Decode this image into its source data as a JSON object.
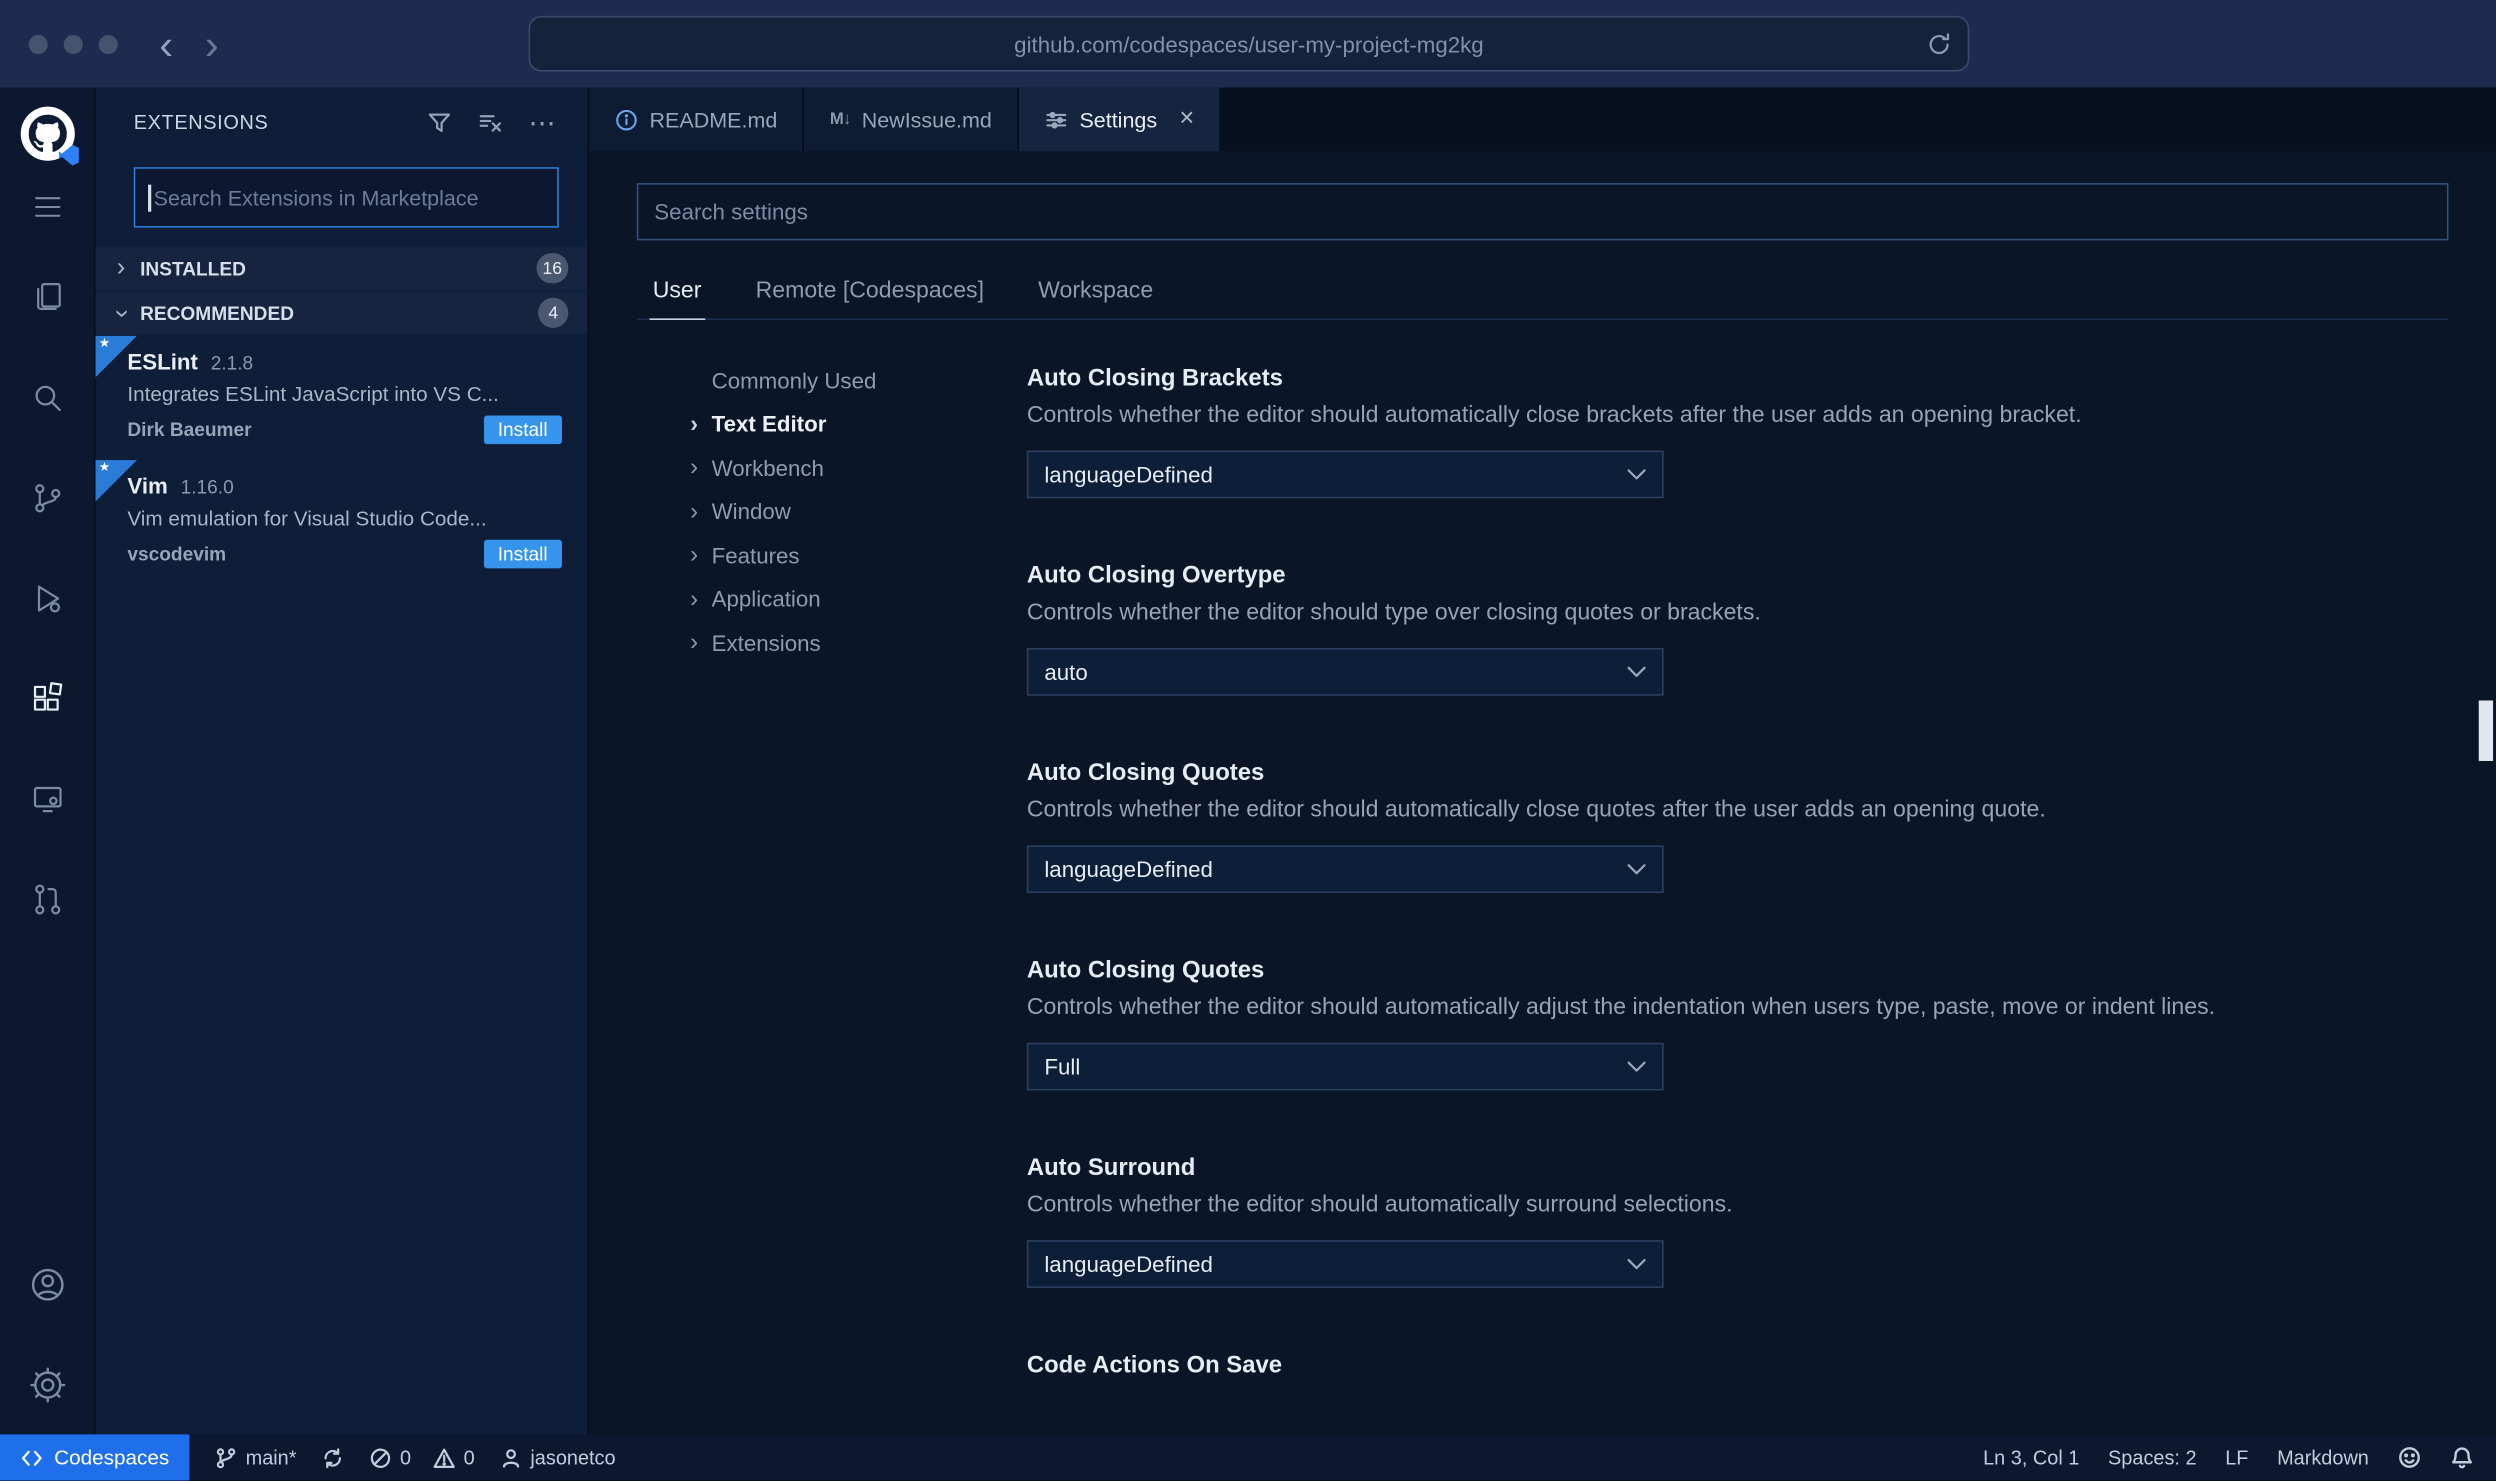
{
  "colors": {
    "accent_blue": "#2f81f7",
    "focus_border": "#2b7cd9",
    "install_button": "#3794ed",
    "codespaces_statusbar": "#1f6feb"
  },
  "icons": {
    "back": "‹",
    "forward": "›",
    "chevron": "›",
    "ellipsis": "⋯",
    "markdown": "M↓",
    "close": "×",
    "star": "★"
  },
  "browser": {
    "url": "github.com/codespaces/user-my-project-mg2kg"
  },
  "extensions_panel": {
    "title": "EXTENSIONS",
    "search_placeholder": "Search Extensions in Marketplace",
    "sections": [
      {
        "label": "INSTALLED",
        "count": "16"
      },
      {
        "label": "RECOMMENDED",
        "count": "4"
      }
    ],
    "items": [
      {
        "name": "ESLint",
        "version": "2.1.8",
        "description": "Integrates ESLint JavaScript into VS C...",
        "author": "Dirk Baeumer",
        "action": "Install"
      },
      {
        "name": "Vim",
        "version": "1.16.0",
        "description": "Vim emulation for Visual Studio Code...",
        "author": "vscodevim",
        "action": "Install"
      }
    ]
  },
  "editor_tabs": [
    {
      "label": "README.md"
    },
    {
      "label": "NewIssue.md"
    },
    {
      "label": "Settings"
    }
  ],
  "settings": {
    "search_placeholder": "Search settings",
    "scopes": [
      {
        "label": "User"
      },
      {
        "label": "Remote [Codespaces]"
      },
      {
        "label": "Workspace"
      }
    ],
    "toc": [
      {
        "label": "Commonly Used"
      },
      {
        "label": "Text Editor"
      },
      {
        "label": "Workbench"
      },
      {
        "label": "Window"
      },
      {
        "label": "Features"
      },
      {
        "label": "Application"
      },
      {
        "label": "Extensions"
      }
    ],
    "items": [
      {
        "title": "Auto Closing Brackets",
        "description": "Controls whether the editor should automatically close brackets after the user adds an opening bracket.",
        "value": "languageDefined"
      },
      {
        "title": "Auto Closing Overtype",
        "description": "Controls whether the editor should type over closing quotes or brackets.",
        "value": "auto"
      },
      {
        "title": "Auto Closing Quotes",
        "description": "Controls whether the editor should automatically close quotes after the user adds an opening quote.",
        "value": "languageDefined"
      },
      {
        "title": "Auto Closing Quotes",
        "description": "Controls whether the editor should automatically adjust the indentation when users type, paste, move or indent lines.",
        "value": "Full"
      },
      {
        "title": "Auto Surround",
        "description": "Controls whether the editor should automatically surround selections.",
        "value": "languageDefined"
      },
      {
        "title": "Code Actions On Save",
        "description": "",
        "value": ""
      }
    ]
  },
  "status_bar": {
    "codespaces_label": "Codespaces",
    "branch": "main*",
    "errors": "0",
    "warnings": "0",
    "user": "jasonetco",
    "cursor_position": "Ln 3, Col 1",
    "indentation": "Spaces: 2",
    "eol": "LF",
    "language": "Markdown"
  }
}
